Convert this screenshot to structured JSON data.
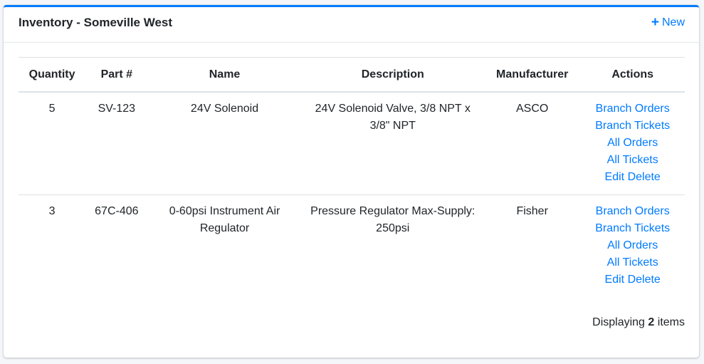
{
  "card": {
    "title": "Inventory - Someville West",
    "new_label": "New",
    "new_icon": "plus-icon",
    "accent_color": "#007bff"
  },
  "table": {
    "headers": [
      "Quantity",
      "Part #",
      "Name",
      "Description",
      "Manufacturer",
      "Actions"
    ],
    "rows": [
      {
        "quantity": "5",
        "part": "SV-123",
        "name": "24V Solenoid",
        "description": "24V Solenoid Valve, 3/8 NPT x 3/8\" NPT",
        "manufacturer": "ASCO",
        "actions": {
          "branch_orders": "Branch Orders",
          "branch_tickets": "Branch Tickets",
          "all_orders": "All Orders",
          "all_tickets": "All Tickets",
          "edit": "Edit",
          "delete": "Delete"
        }
      },
      {
        "quantity": "3",
        "part": "67C-406",
        "name": "0-60psi Instrument Air Regulator",
        "description": "Pressure Regulator Max-Supply: 250psi",
        "manufacturer": "Fisher",
        "actions": {
          "branch_orders": "Branch Orders",
          "branch_tickets": "Branch Tickets",
          "all_orders": "All Orders",
          "all_tickets": "All Tickets",
          "edit": "Edit",
          "delete": "Delete"
        }
      }
    ]
  },
  "footer": {
    "prefix": "Displaying",
    "count": "2",
    "suffix": "items"
  }
}
